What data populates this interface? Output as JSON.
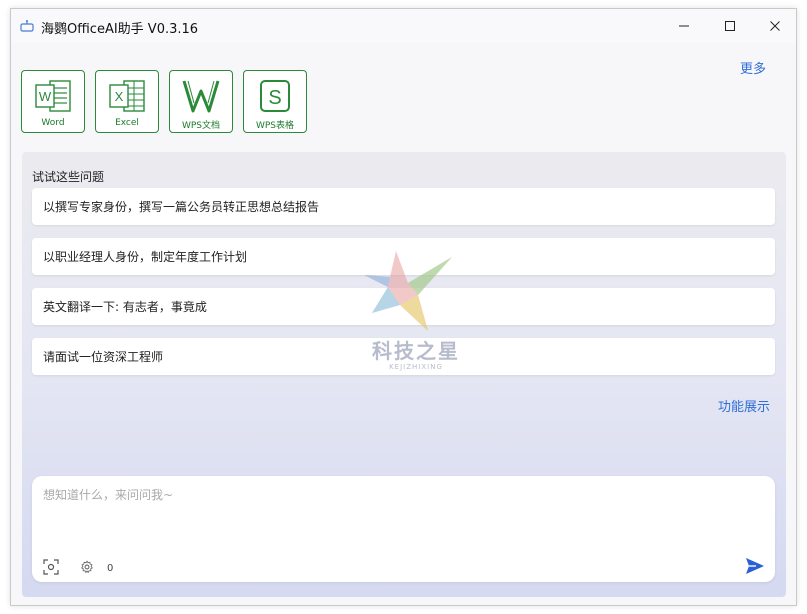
{
  "window": {
    "title": "海鹦OfficeAI助手 V0.3.16"
  },
  "apps": [
    {
      "label": "Word",
      "glyph": "W",
      "icon": "word-icon"
    },
    {
      "label": "Excel",
      "glyph": "X",
      "icon": "excel-icon"
    },
    {
      "label": "WPS文档",
      "glyph": "W",
      "icon": "wps-doc-icon"
    },
    {
      "label": "WPS表格",
      "glyph": "S",
      "icon": "wps-sheet-icon"
    }
  ],
  "header": {
    "more_label": "更多"
  },
  "suggestions": {
    "title": "试试这些问题",
    "items": [
      "以撰写专家身份，撰写一篇公务员转正思想总结报告",
      "以职业经理人身份，制定年度工作计划",
      "英文翻译一下: 有志者，事竟成",
      "请面试一位资深工程师"
    ]
  },
  "feature_label": "功能展示",
  "input": {
    "placeholder": "想知道什么，来问问我~",
    "value": "",
    "count": "0"
  },
  "watermark": {
    "text": "科技之星",
    "sub": "KEJIZHIXING"
  },
  "colors": {
    "accent": "#2f6fd6",
    "office_green": "#2a8a3a",
    "send_blue": "#2a5fd6"
  }
}
